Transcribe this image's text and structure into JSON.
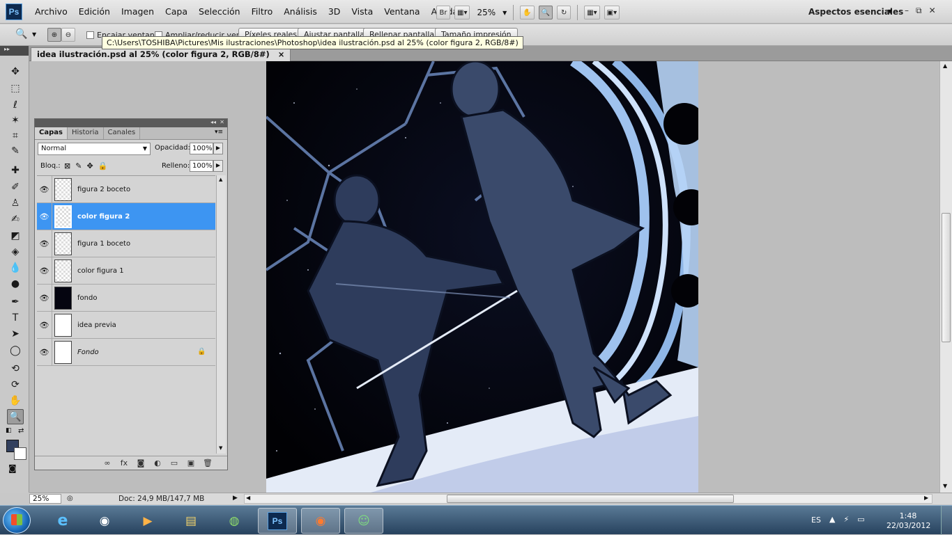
{
  "menubar": {
    "logo": "Ps",
    "items": [
      "Archivo",
      "Edición",
      "Imagen",
      "Capa",
      "Selección",
      "Filtro",
      "Análisis",
      "3D",
      "Vista",
      "Ventana",
      "Ayuda"
    ],
    "bridge": "Br",
    "zoom": "25%",
    "workspace": "Aspectos esenciales",
    "window_buttons": [
      "–",
      "⧉",
      "✕"
    ]
  },
  "optionsbar": {
    "chk_fit_window": "Encajar ventana",
    "chk_resize": "Ampliar/reducir vent",
    "btn_actual_pixels": "Píxeles reales",
    "btn_fit_screen": "Ajustar pantalla",
    "btn_fill_screen": "Rellenar pantalla",
    "btn_print_size": "Tamaño impresión"
  },
  "tooltip": "C:\\Users\\TOSHIBA\\Pictures\\Mis ilustraciones\\Photoshop\\idea ilustración.psd al 25% (color figura 2, RGB/8#)",
  "document": {
    "tab_title": "idea ilustración.psd al 25% (color figura 2, RGB/8#)",
    "tab_close": "×"
  },
  "status": {
    "zoom": "25%",
    "doc_size": "Doc: 24,9 MB/147,7 MB"
  },
  "colors": {
    "foreground": "#32405e",
    "background": "#ffffff",
    "layer_selected": "#3d95f2"
  },
  "layers_panel": {
    "tabs": [
      "Capas",
      "Historia",
      "Canales"
    ],
    "blend_mode": "Normal",
    "opacity_label": "Opacidad:",
    "opacity": "100%",
    "lock_label": "Bloq.:",
    "fill_label": "Relleno:",
    "fill": "100%",
    "layers": [
      {
        "name": "figura 2 boceto",
        "visible": true
      },
      {
        "name": "color figura 2",
        "visible": true
      },
      {
        "name": "figura 1 boceto",
        "visible": true
      },
      {
        "name": "color figura 1",
        "visible": true
      },
      {
        "name": "fondo",
        "visible": true
      },
      {
        "name": "idea previa",
        "visible": true
      },
      {
        "name": "Fondo",
        "visible": true,
        "locked": true
      }
    ]
  },
  "taskbar": {
    "apps": [
      "internet-explorer",
      "user-account",
      "media-player",
      "file-explorer",
      "image-viewer",
      "photoshop",
      "firefox",
      "messenger"
    ],
    "ps_label": "Ps",
    "lang": "ES",
    "time": "1:48",
    "date": "22/03/2012"
  }
}
